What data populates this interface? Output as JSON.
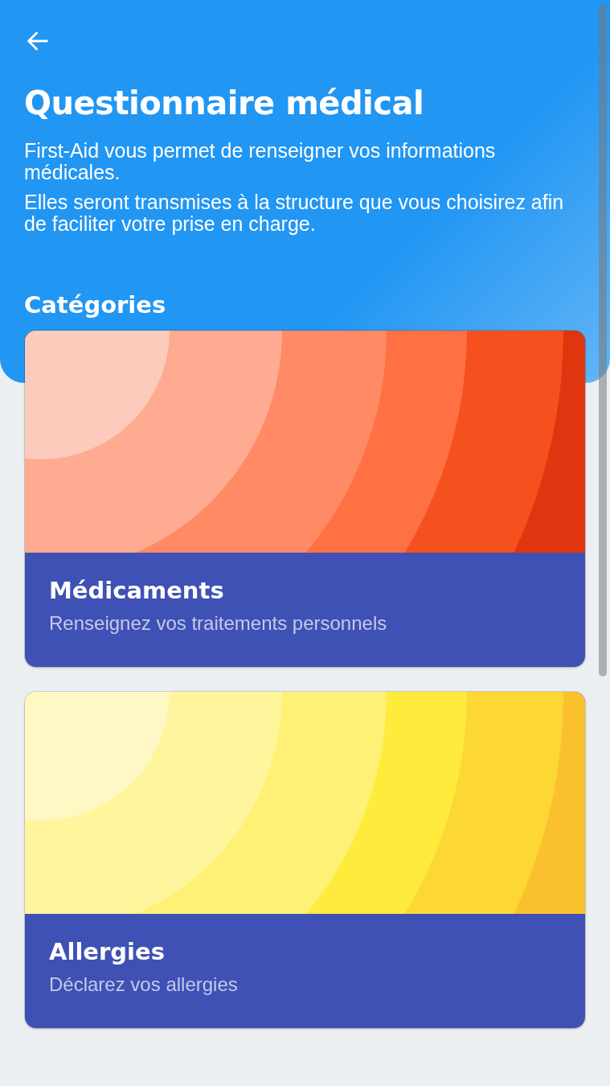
{
  "header": {
    "title": "Questionnaire médical",
    "paragraphs": [
      "First-Aid vous permet de renseigner vos informations médicales.",
      "Elles seront transmises à la structure que vous choisirez afin de faciliter votre prise en charge."
    ],
    "section_title": "Catégories"
  },
  "categories": [
    {
      "title": "Médicaments",
      "subtitle": "Renseignez vos traitements personnels"
    },
    {
      "title": "Allergies",
      "subtitle": "Déclarez vos allergies"
    }
  ]
}
